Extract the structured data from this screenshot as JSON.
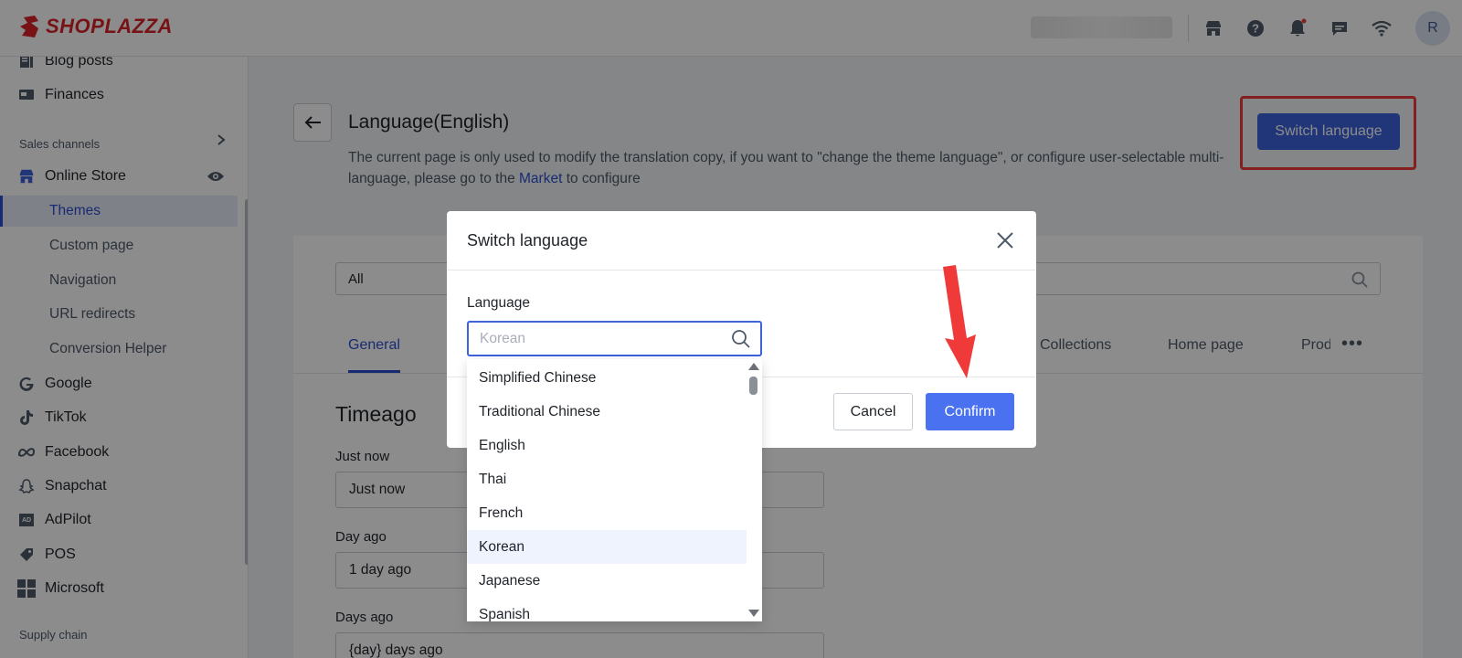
{
  "header": {
    "logo_text": "SHOPLAZZA",
    "avatar_initial": "R",
    "icons": [
      "store-icon",
      "help-icon",
      "bell-icon",
      "message-icon",
      "wifi-icon"
    ]
  },
  "sidebar": {
    "top_items": [
      {
        "label": "Blog posts",
        "icon": "blog-icon"
      },
      {
        "label": "Finances",
        "icon": "finances-icon"
      }
    ],
    "sales_channels_label": "Sales channels",
    "online_store_label": "Online Store",
    "online_store_sub": [
      {
        "label": "Themes",
        "active": true
      },
      {
        "label": "Custom page"
      },
      {
        "label": "Navigation"
      },
      {
        "label": "URL redirects"
      },
      {
        "label": "Conversion Helper"
      }
    ],
    "channels": [
      {
        "label": "Google",
        "icon": "google-icon"
      },
      {
        "label": "TikTok",
        "icon": "tiktok-icon"
      },
      {
        "label": "Facebook",
        "icon": "meta-icon"
      },
      {
        "label": "Snapchat",
        "icon": "snapchat-icon"
      },
      {
        "label": "AdPilot",
        "icon": "adpilot-icon"
      },
      {
        "label": "POS",
        "icon": "pos-icon"
      },
      {
        "label": "Microsoft",
        "icon": "microsoft-icon"
      }
    ],
    "supply_chain_label": "Supply chain"
  },
  "page": {
    "title": "Language(English)",
    "desc_part1": "The current page is only used to modify the translation copy, if you want to \"change the theme language\", or configure user-selectable multi-language, please go to the ",
    "desc_link": "Market",
    "desc_part2": " to configure",
    "switch_language_label": "Switch language",
    "filter_value": "All",
    "tabs": [
      "General",
      "Collections",
      "Home page",
      "Prod"
    ],
    "more_label": "•••",
    "section_title": "Timeago",
    "fields": [
      {
        "label": "Just now",
        "value": "Just now"
      },
      {
        "label": "Day ago",
        "value": "1 day ago"
      },
      {
        "label": "Days ago",
        "value": "{day} days ago"
      }
    ]
  },
  "modal": {
    "title": "Switch language",
    "language_label": "Language",
    "search_placeholder": "Korean",
    "cancel_label": "Cancel",
    "confirm_label": "Confirm",
    "options": [
      {
        "label": "Simplified Chinese"
      },
      {
        "label": "Traditional Chinese"
      },
      {
        "label": "English"
      },
      {
        "label": "Thai"
      },
      {
        "label": "French"
      },
      {
        "label": "Korean",
        "selected": true
      },
      {
        "label": "Japanese"
      },
      {
        "label": "Spanish"
      }
    ]
  },
  "colors": {
    "accent": "#3d63dd",
    "confirm": "#4a72f0",
    "annotation_red": "#f03a3a",
    "logo_red": "#d9232a"
  }
}
